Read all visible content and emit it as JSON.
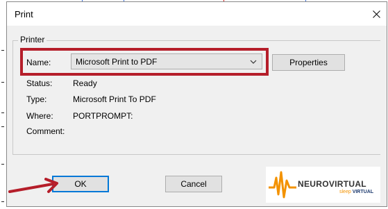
{
  "window": {
    "title": "Print"
  },
  "printer_group": {
    "legend": "Printer",
    "name_label": "Name:",
    "name_value": "Microsoft Print to PDF",
    "properties_label": "Properties",
    "status_label": "Status:",
    "status_value": "Ready",
    "type_label": "Type:",
    "type_value": "Microsoft Print To PDF",
    "where_label": "Where:",
    "where_value": "PORTPROMPT:",
    "comment_label": "Comment:"
  },
  "buttons": {
    "ok_label": "OK",
    "cancel_label": "Cancel"
  },
  "logo": {
    "name": "NEUROVIRTUAL",
    "tagline_a": "sleep",
    "tagline_b": "VIRTUAL"
  },
  "colors": {
    "highlight": "#b51e2a",
    "arrow": "#b51e2a",
    "focus_border": "#0078d7",
    "logo_orange": "#f39200",
    "logo_navy": "#1d3a6e"
  }
}
